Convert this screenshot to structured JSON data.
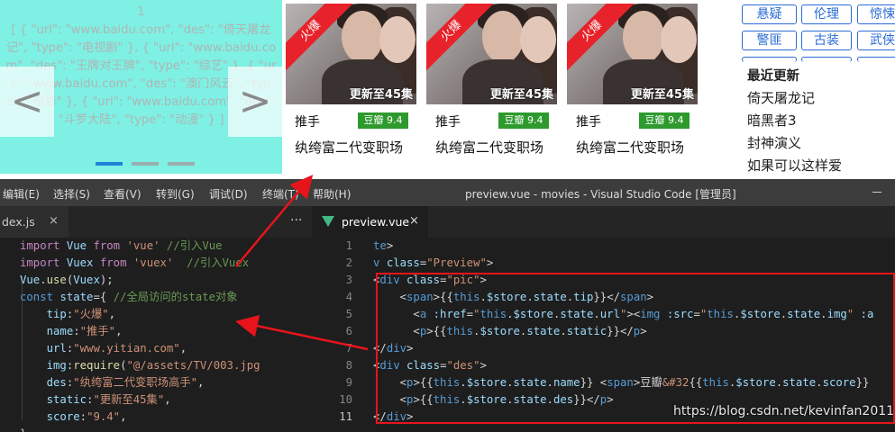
{
  "carousel": {
    "index": "1",
    "text": "[ { \"url\": \"www.baidu.com\", \"des\": \"倚天屠龙记\", \"type\": \"电视剧\" }, { \"url\": \"www.baidu.com\", \"des\": \"王牌对王牌\", \"type\": \"综艺\" }, { \"url\": \"www.baidu.com\", \"des\": \"澳门风云\", \"type\": \"电影\" }, { \"url\": \"www.baidu.com\", \"des\": \"斗罗大陆\", \"type\": \"动漫\" } ]",
    "prev_label": "<",
    "next_label": ">",
    "active_dot": 0
  },
  "cards": [
    {
      "tip": "火爆",
      "static": "更新至45集",
      "name": "推手",
      "score": "豆瓣 9.4",
      "des": "纨绔富二代变职场"
    },
    {
      "tip": "火爆",
      "static": "更新至45集",
      "name": "推手",
      "score": "豆瓣 9.4",
      "des": "纨绔富二代变职场"
    },
    {
      "tip": "火爆",
      "static": "更新至45集",
      "name": "推手",
      "score": "豆瓣 9.4",
      "des": "纨绔富二代变职场"
    }
  ],
  "tags": [
    "悬疑",
    "伦理",
    "惊悚",
    "警匪",
    "古装",
    "武侠"
  ],
  "latest": {
    "title": "最近更新",
    "items": [
      "倚天屠龙记",
      "暗黑者3",
      "封神演义",
      "如果可以这样爱"
    ]
  },
  "vscode": {
    "menu": [
      "编辑(E)",
      "选择(S)",
      "查看(V)",
      "转到(G)",
      "调试(D)",
      "终端(T)",
      "帮助(H)"
    ],
    "window_title": "preview.vue - movies - Visual Studio Code [管理员]",
    "left_tab": "dex.js",
    "right_tab": "preview.vue",
    "close_glyph": "×",
    "more_glyph": "···",
    "line_numbers": [
      "1",
      "2",
      "3",
      "4",
      "5",
      "6",
      "7",
      "8",
      "9",
      "10",
      "11"
    ],
    "current_line": "11",
    "watermark": "https://blog.csdn.net/kevinfan2011"
  },
  "colors": {
    "carousel_bg": "#7ff0e4",
    "tag_blue": "#2a6bd4",
    "ribbon_red": "#e8222a",
    "score_green": "#2e9a2e",
    "highlight_red": "#e8141b",
    "editor_bg": "#1e1e1e"
  }
}
